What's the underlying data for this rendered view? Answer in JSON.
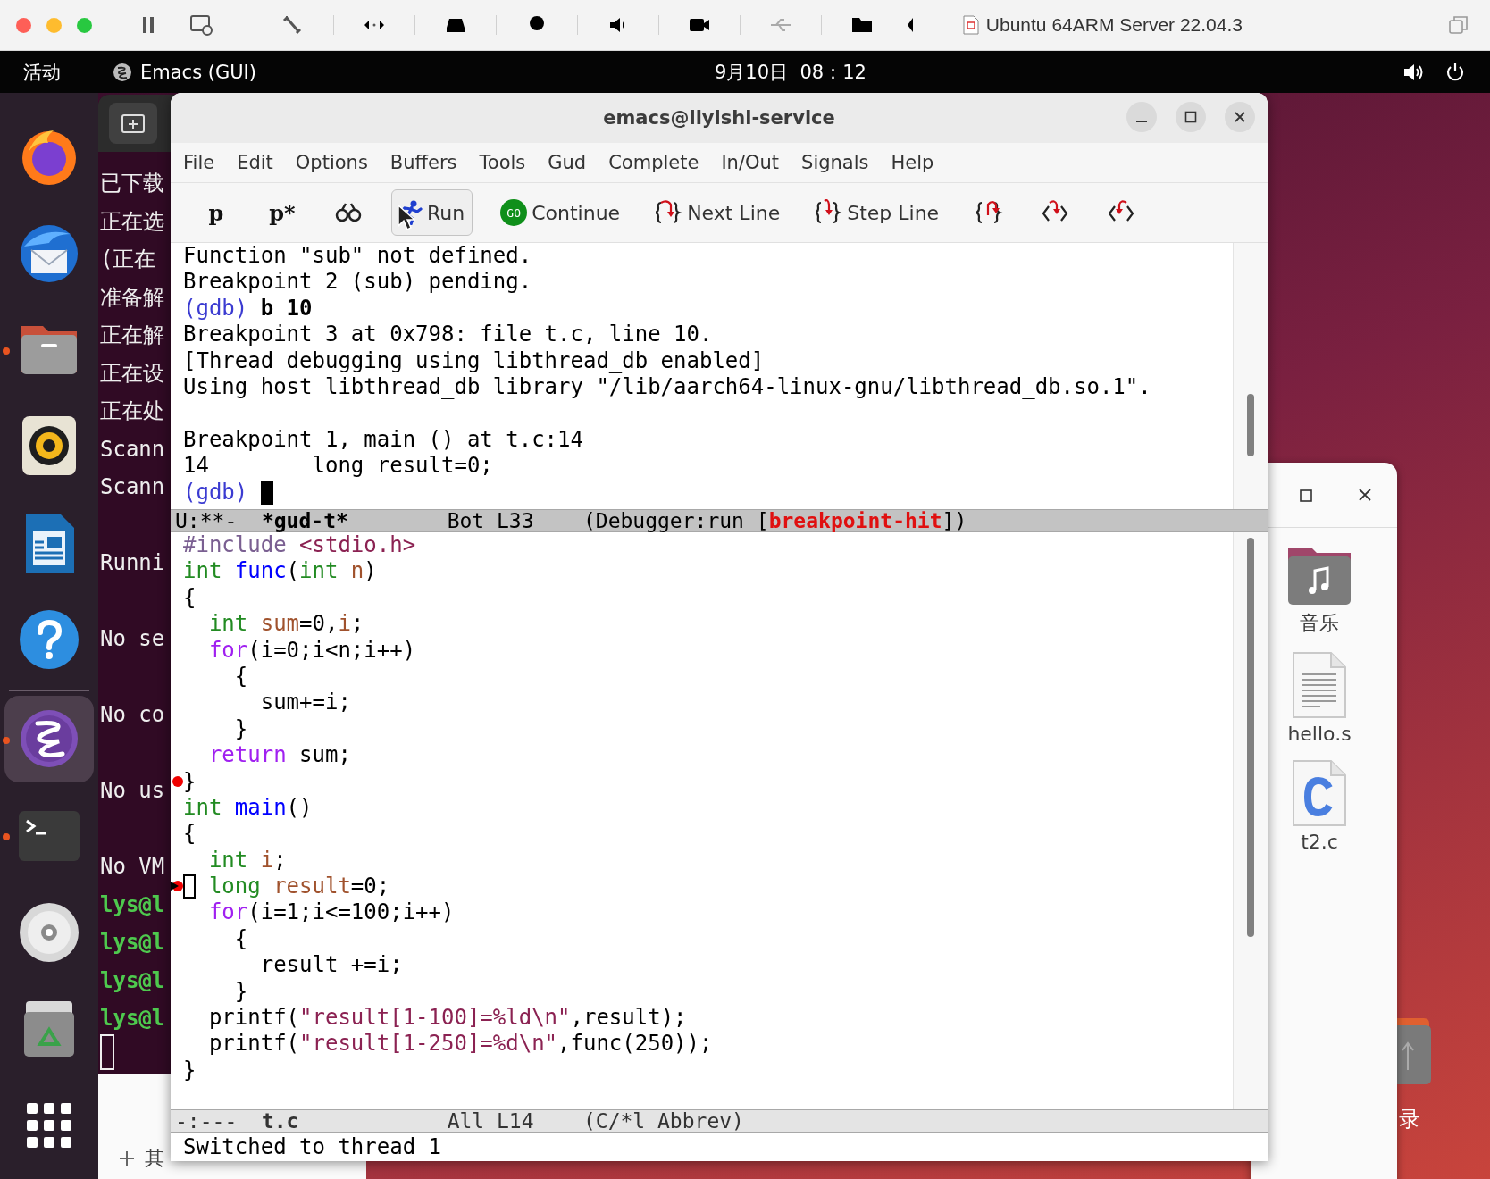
{
  "host_window": {
    "title": "Ubuntu 64ARM Server 22.04.3"
  },
  "top_bar": {
    "activities": "活动",
    "app": "Emacs (GUI)",
    "clock": "9月10日  08：12"
  },
  "dock": [
    {
      "kind": "browser",
      "running": false,
      "selected": false
    },
    {
      "kind": "mail",
      "running": false,
      "selected": false
    },
    {
      "kind": "files",
      "running": true,
      "selected": false
    },
    {
      "kind": "speaker",
      "running": false,
      "selected": false
    },
    {
      "kind": "document",
      "running": false,
      "selected": false
    },
    {
      "kind": "help",
      "running": false,
      "selected": false
    },
    {
      "kind": "editor",
      "running": true,
      "selected": true
    },
    {
      "kind": "terminal",
      "running": true,
      "selected": false
    },
    {
      "kind": "disc",
      "running": false,
      "selected": false
    },
    {
      "kind": "trash",
      "running": false,
      "selected": false
    },
    {
      "kind": "grid",
      "running": false,
      "selected": false
    }
  ],
  "terminal": {
    "blocks": [
      [
        {
          "text": "已下载",
          "kind": "output"
        },
        {
          "text": "正在选",
          "kind": "output"
        },
        {
          "text": "(正在",
          "kind": "output"
        },
        {
          "text": "准备解",
          "kind": "output"
        },
        {
          "text": "正在解",
          "kind": "output"
        },
        {
          "text": "正在设",
          "kind": "output"
        },
        {
          "text": "正在处",
          "kind": "output"
        },
        {
          "text": "Scann",
          "kind": "output"
        },
        {
          "text": "Scann",
          "kind": "output"
        }
      ],
      [
        {
          "text": "Runni",
          "kind": "output"
        }
      ],
      [
        {
          "text": "No se",
          "kind": "output"
        }
      ],
      [
        {
          "text": "No co",
          "kind": "output"
        }
      ],
      [
        {
          "text": "No us",
          "kind": "output"
        }
      ],
      [
        {
          "text": "No VM",
          "kind": "output"
        },
        {
          "text": "lys@l",
          "kind": "prompt"
        },
        {
          "text": "lys@l",
          "kind": "prompt"
        },
        {
          "text": "lys@l",
          "kind": "prompt"
        },
        {
          "text": "lys@l",
          "kind": "prompt"
        }
      ]
    ]
  },
  "files_sidebar": {
    "item": "其"
  },
  "emacs": {
    "title": "emacs@liyishi-service",
    "menu": [
      "File",
      "Edit",
      "Options",
      "Buffers",
      "Tools",
      "Gud",
      "Complete",
      "In/Out",
      "Signals",
      "Help"
    ],
    "toolbar": [
      {
        "kind": "text",
        "label": "p",
        "selected": false
      },
      {
        "kind": "text",
        "label": "p*",
        "selected": false
      },
      {
        "kind": "watch",
        "selected": false
      },
      {
        "kind": "run",
        "label": "Run",
        "selected": true
      },
      {
        "kind": "continue",
        "badge": "GO",
        "label": "Continue",
        "selected": false
      },
      {
        "kind": "next",
        "label": "Next Line",
        "selected": false
      },
      {
        "kind": "step",
        "label": "Step Line",
        "selected": false
      },
      {
        "kind": "stepi",
        "selected": false
      },
      {
        "kind": "down",
        "selected": false
      },
      {
        "kind": "up",
        "selected": false
      }
    ],
    "gud": {
      "blocks": [
        [
          {
            "cursor": false,
            "tokens": [
              {
                "kind": "plain",
                "text": "Function \"sub\" not defined."
              }
            ]
          },
          {
            "cursor": false,
            "tokens": [
              {
                "kind": "plain",
                "text": "Breakpoint 2 (sub) pending."
              }
            ]
          },
          {
            "cursor": false,
            "tokens": [
              {
                "kind": "prompt",
                "text": "(gdb)"
              },
              {
                "kind": "command",
                "text": " b 10"
              }
            ]
          },
          {
            "cursor": false,
            "tokens": [
              {
                "kind": "plain",
                "text": "Breakpoint 3 at 0x798: file t.c, line 10."
              }
            ]
          },
          {
            "cursor": false,
            "tokens": [
              {
                "kind": "plain",
                "text": "[Thread debugging using libthread_db enabled]"
              }
            ]
          },
          {
            "cursor": false,
            "tokens": [
              {
                "kind": "plain",
                "text": "Using host libthread_db library \"/lib/aarch64-linux-gnu/libthread_db.so.1\"."
              }
            ]
          }
        ],
        [
          {
            "cursor": false,
            "tokens": [
              {
                "kind": "plain",
                "text": "Breakpoint 1, main () at t.c:14"
              }
            ]
          },
          {
            "cursor": false,
            "tokens": [
              {
                "kind": "plain",
                "text": "14        long result=0;"
              }
            ]
          },
          {
            "cursor": true,
            "tokens": [
              {
                "kind": "prompt",
                "text": "(gdb)"
              }
            ]
          }
        ]
      ],
      "mode_line": {
        "active": true,
        "status": "U:**-",
        "buffer": "*gud-t*",
        "position": "Bot L33",
        "mode": "(Debugger:run [",
        "state": "breakpoint-hit",
        "mode_end": "])"
      }
    },
    "source": {
      "lines": [
        {
          "breakpoint": false,
          "current": false,
          "tokens": [
            {
              "kind": "preproc",
              "text": "#include"
            },
            {
              "kind": "string",
              "text": " <stdio.h>"
            }
          ]
        },
        {
          "breakpoint": false,
          "current": false,
          "tokens": [
            {
              "kind": "type",
              "text": "int"
            },
            {
              "kind": "func",
              "text": " func"
            },
            {
              "kind": "plain",
              "text": "("
            },
            {
              "kind": "type",
              "text": "int"
            },
            {
              "kind": "var",
              "text": " n"
            },
            {
              "kind": "plain",
              "text": ")"
            }
          ]
        },
        {
          "breakpoint": false,
          "current": false,
          "tokens": [
            {
              "kind": "plain",
              "text": "{"
            }
          ]
        },
        {
          "breakpoint": false,
          "current": false,
          "tokens": [
            {
              "kind": "type",
              "text": "  int"
            },
            {
              "kind": "var",
              "text": " sum"
            },
            {
              "kind": "plain",
              "text": "=0,"
            },
            {
              "kind": "var",
              "text": "i"
            },
            {
              "kind": "plain",
              "text": ";"
            }
          ]
        },
        {
          "breakpoint": false,
          "current": false,
          "tokens": [
            {
              "kind": "keyword",
              "text": "  for"
            },
            {
              "kind": "plain",
              "text": "(i=0;i<n;i++)"
            }
          ]
        },
        {
          "breakpoint": false,
          "current": false,
          "tokens": [
            {
              "kind": "plain",
              "text": "    {"
            }
          ]
        },
        {
          "breakpoint": false,
          "current": false,
          "tokens": [
            {
              "kind": "plain",
              "text": "      sum+=i;"
            }
          ]
        },
        {
          "breakpoint": false,
          "current": false,
          "tokens": [
            {
              "kind": "plain",
              "text": "    }"
            }
          ]
        },
        {
          "breakpoint": false,
          "current": false,
          "tokens": [
            {
              "kind": "keyword",
              "text": "  return"
            },
            {
              "kind": "plain",
              "text": " sum;"
            }
          ]
        },
        {
          "breakpoint": true,
          "current": false,
          "tokens": [
            {
              "kind": "plain",
              "text": "}"
            }
          ]
        },
        {
          "breakpoint": false,
          "current": false,
          "tokens": [
            {
              "kind": "type",
              "text": "int"
            },
            {
              "kind": "func",
              "text": " main"
            },
            {
              "kind": "plain",
              "text": "()"
            }
          ]
        },
        {
          "breakpoint": false,
          "current": false,
          "tokens": [
            {
              "kind": "plain",
              "text": "{"
            }
          ]
        },
        {
          "breakpoint": false,
          "current": false,
          "tokens": [
            {
              "kind": "type",
              "text": "  int"
            },
            {
              "kind": "var",
              "text": " i"
            },
            {
              "kind": "plain",
              "text": ";"
            }
          ]
        },
        {
          "breakpoint": true,
          "current": true,
          "tokens": [
            {
              "kind": "type",
              "text": "  long"
            },
            {
              "kind": "var",
              "text": " result"
            },
            {
              "kind": "plain",
              "text": "=0;"
            }
          ]
        },
        {
          "breakpoint": false,
          "current": false,
          "tokens": [
            {
              "kind": "keyword",
              "text": "  for"
            },
            {
              "kind": "plain",
              "text": "(i=1;i<=100;i++)"
            }
          ]
        },
        {
          "breakpoint": false,
          "current": false,
          "tokens": [
            {
              "kind": "plain",
              "text": "    {"
            }
          ]
        },
        {
          "breakpoint": false,
          "current": false,
          "tokens": [
            {
              "kind": "plain",
              "text": "      result +=i;"
            }
          ]
        },
        {
          "breakpoint": false,
          "current": false,
          "tokens": [
            {
              "kind": "plain",
              "text": "    }"
            }
          ]
        },
        {
          "breakpoint": false,
          "current": false,
          "tokens": [
            {
              "kind": "plain",
              "text": "  printf("
            },
            {
              "kind": "string",
              "text": "\"result[1-100]=%ld\\n\""
            },
            {
              "kind": "plain",
              "text": ",result);"
            }
          ]
        },
        {
          "breakpoint": false,
          "current": false,
          "tokens": [
            {
              "kind": "plain",
              "text": "  printf("
            },
            {
              "kind": "string",
              "text": "\"result[1-250]=%d\\n\""
            },
            {
              "kind": "plain",
              "text": ",func(250));"
            }
          ]
        },
        {
          "breakpoint": false,
          "current": false,
          "tokens": [
            {
              "kind": "plain",
              "text": "}"
            }
          ]
        }
      ],
      "mode_line": {
        "active": false,
        "status": "-:---",
        "buffer": "t.c",
        "position": "All L14",
        "mode": "(C/*l Abbrev)"
      }
    },
    "echo": "Switched to thread 1"
  },
  "file_manager": {
    "items": [
      {
        "kind": "music-folder",
        "label": "音乐"
      },
      {
        "kind": "text-file",
        "label": "hello.s"
      },
      {
        "kind": "c-file",
        "label": "t2.c"
      }
    ]
  },
  "desktop": {
    "items": [
      {
        "label": "录"
      }
    ]
  }
}
